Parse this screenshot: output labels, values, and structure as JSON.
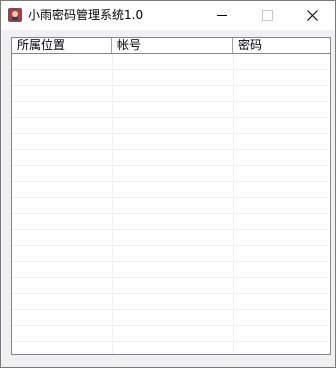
{
  "window": {
    "title": "小雨密码管理系统1.0",
    "app_icon": "app-icon"
  },
  "controls": {
    "minimize_icon": "minimize-icon",
    "maximize_icon": "maximize-icon",
    "close_icon": "close-icon"
  },
  "listview": {
    "columns": [
      "所属位置",
      "帐号",
      "密码"
    ],
    "rows": []
  },
  "colors": {
    "title_bar": "#ffffff",
    "window_bg": "#f0f0f0",
    "grid": "#f0f0f0",
    "border": "#828790"
  }
}
